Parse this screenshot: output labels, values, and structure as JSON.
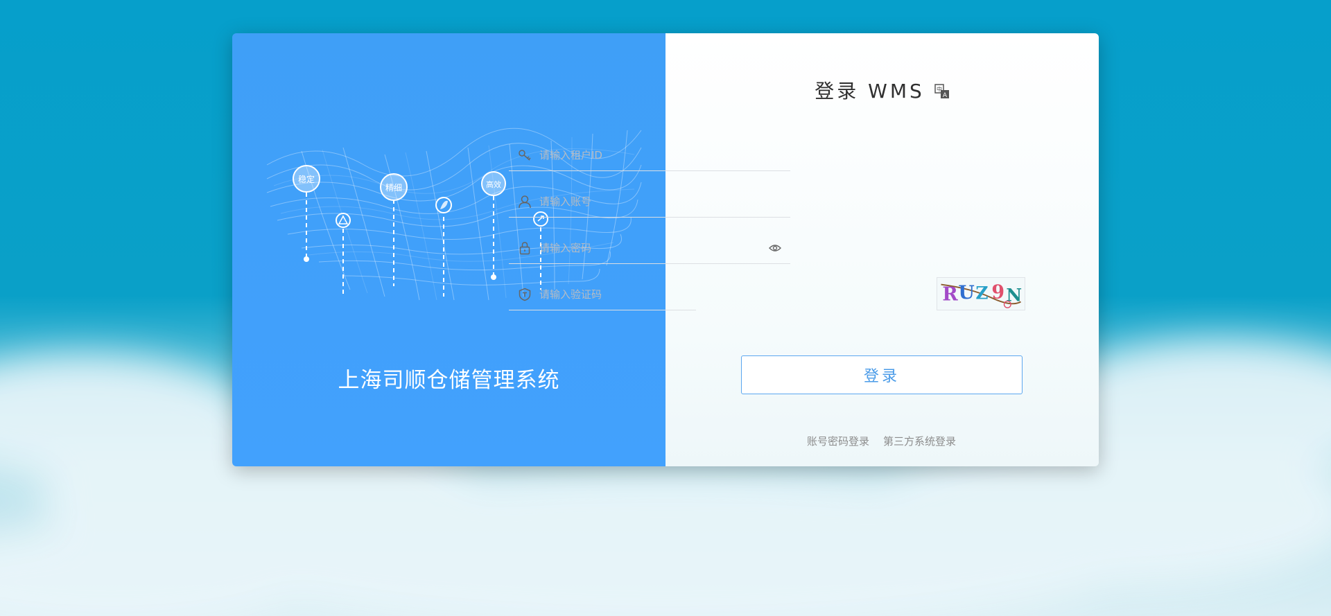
{
  "left_panel": {
    "system_name": "上海司顺仓储管理系统",
    "badges": [
      "稳定",
      "精细",
      "高效"
    ]
  },
  "login": {
    "title": "登录 WMS",
    "tenant": {
      "placeholder": "请输入租户ID"
    },
    "account": {
      "placeholder": "请输入账号"
    },
    "password": {
      "placeholder": "请输入密码"
    },
    "captcha": {
      "placeholder": "请输入验证码",
      "code": "RUZ9N"
    },
    "submit_label": "登录",
    "links": [
      "账号密码登录",
      "第三方系统登录"
    ]
  },
  "colors": {
    "left_panel_bg": "#42a1fd",
    "button_border": "#5aa6ef",
    "button_text": "#4a9be8"
  }
}
